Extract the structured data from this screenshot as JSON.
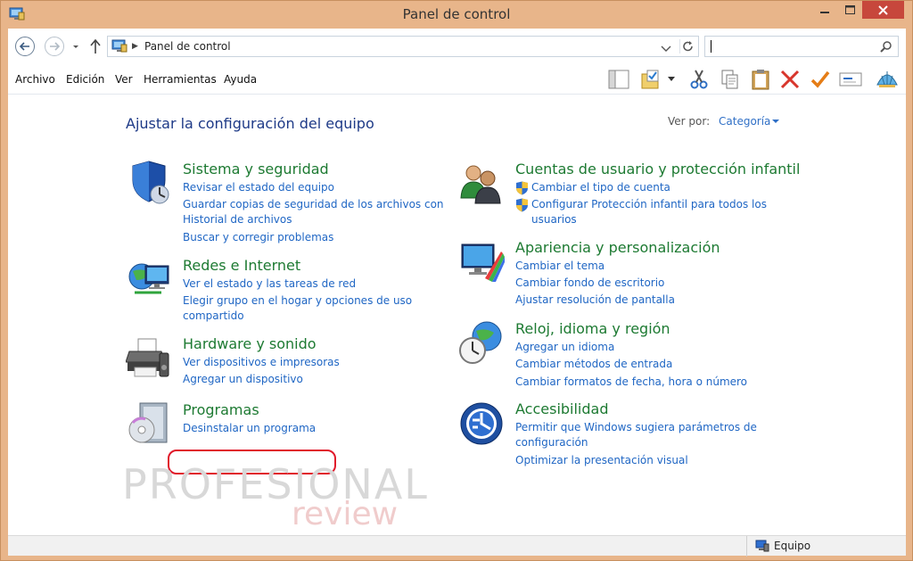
{
  "window": {
    "title": "Panel de control"
  },
  "address": {
    "path": "Panel de control",
    "search_value": ""
  },
  "menu": {
    "items": [
      "Archivo",
      "Edición",
      "Ver",
      "Herramientas",
      "Ayuda"
    ]
  },
  "content": {
    "title": "Ajustar la configuración del equipo",
    "view_by_label": "Ver por:",
    "view_by_value": "Categoría"
  },
  "categories": {
    "sistema": {
      "title": "Sistema y seguridad",
      "links": [
        "Revisar el estado del equipo",
        "Guardar copias de seguridad de los archivos con",
        "Historial de archivos",
        "Buscar y corregir problemas"
      ]
    },
    "redes": {
      "title": "Redes e Internet",
      "links": [
        "Ver el estado y las tareas de red",
        "Elegir grupo en el hogar y opciones de uso",
        "compartido"
      ]
    },
    "hardware": {
      "title": "Hardware y sonido",
      "links": [
        "Ver dispositivos e impresoras",
        "Agregar un dispositivo"
      ]
    },
    "programas": {
      "title": "Programas",
      "links": [
        "Desinstalar un programa"
      ]
    },
    "cuentas": {
      "title": "Cuentas de usuario y protección infantil",
      "links": [
        "Cambiar el tipo de cuenta",
        "Configurar Protección infantil para todos los",
        "usuarios"
      ]
    },
    "apariencia": {
      "title": "Apariencia y personalización",
      "links": [
        "Cambiar el tema",
        "Cambiar fondo de escritorio",
        "Ajustar resolución de pantalla"
      ]
    },
    "reloj": {
      "title": "Reloj, idioma y región",
      "links": [
        "Agregar un idioma",
        "Cambiar métodos de entrada",
        "Cambiar formatos de fecha, hora o número"
      ]
    },
    "accesibilidad": {
      "title": "Accesibilidad",
      "links": [
        "Permitir que Windows sugiera parámetros de",
        "configuración",
        "Optimizar la presentación visual"
      ]
    }
  },
  "watermark": {
    "line1": "PROFESIONAL",
    "line2": "review"
  },
  "status": {
    "text": "Equipo"
  },
  "colors": {
    "frame": "#e8b58a",
    "close": "#c7473c",
    "category_title": "#1d7a32",
    "link": "#1f66c4",
    "page_title": "#1e3a87",
    "highlight": "#e0192b"
  }
}
